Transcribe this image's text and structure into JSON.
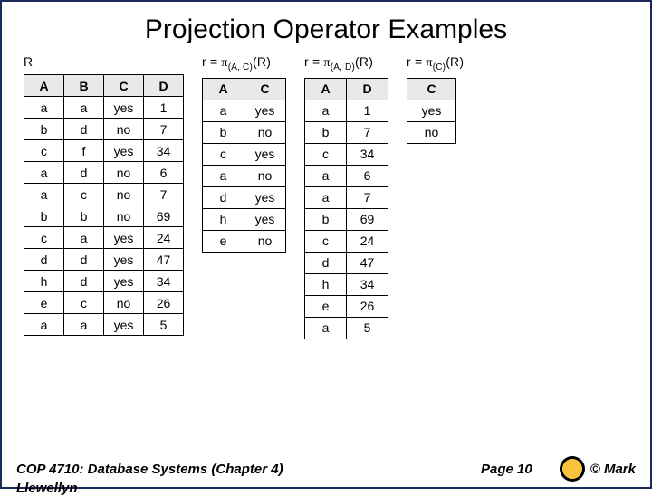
{
  "title": "Projection Operator Examples",
  "relationR": {
    "label": "R",
    "headers": [
      "A",
      "B",
      "C",
      "D"
    ],
    "rows": [
      [
        "a",
        "a",
        "yes",
        "1"
      ],
      [
        "b",
        "d",
        "no",
        "7"
      ],
      [
        "c",
        "f",
        "yes",
        "34"
      ],
      [
        "a",
        "d",
        "no",
        "6"
      ],
      [
        "a",
        "c",
        "no",
        "7"
      ],
      [
        "b",
        "b",
        "no",
        "69"
      ],
      [
        "c",
        "a",
        "yes",
        "24"
      ],
      [
        "d",
        "d",
        "yes",
        "47"
      ],
      [
        "h",
        "d",
        "yes",
        "34"
      ],
      [
        "e",
        "c",
        "no",
        "26"
      ],
      [
        "a",
        "a",
        "yes",
        "5"
      ]
    ]
  },
  "projAC": {
    "label_prefix": "r = ",
    "pi": "π",
    "subscript": "(A, C)",
    "label_suffix": "(R)",
    "headers": [
      "A",
      "C"
    ],
    "rows": [
      [
        "a",
        "yes"
      ],
      [
        "b",
        "no"
      ],
      [
        "c",
        "yes"
      ],
      [
        "a",
        "no"
      ],
      [
        "d",
        "yes"
      ],
      [
        "h",
        "yes"
      ],
      [
        "e",
        "no"
      ]
    ]
  },
  "projAD": {
    "label_prefix": "r = ",
    "pi": "π",
    "subscript": "(A, D)",
    "label_suffix": "(R)",
    "headers": [
      "A",
      "D"
    ],
    "rows": [
      [
        "a",
        "1"
      ],
      [
        "b",
        "7"
      ],
      [
        "c",
        "34"
      ],
      [
        "a",
        "6"
      ],
      [
        "a",
        "7"
      ],
      [
        "b",
        "69"
      ],
      [
        "c",
        "24"
      ],
      [
        "d",
        "47"
      ],
      [
        "h",
        "34"
      ],
      [
        "e",
        "26"
      ],
      [
        "a",
        "5"
      ]
    ]
  },
  "projC": {
    "label_prefix": "r = ",
    "pi": "π",
    "subscript": "(C)",
    "label_suffix": "(R)",
    "headers": [
      "C"
    ],
    "rows": [
      [
        "yes"
      ],
      [
        "no"
      ]
    ]
  },
  "footer": {
    "left": "COP 4710: Database Systems  (Chapter 4)",
    "mid": "Page 10",
    "right": "© Mark",
    "cut": "Llewellyn"
  }
}
